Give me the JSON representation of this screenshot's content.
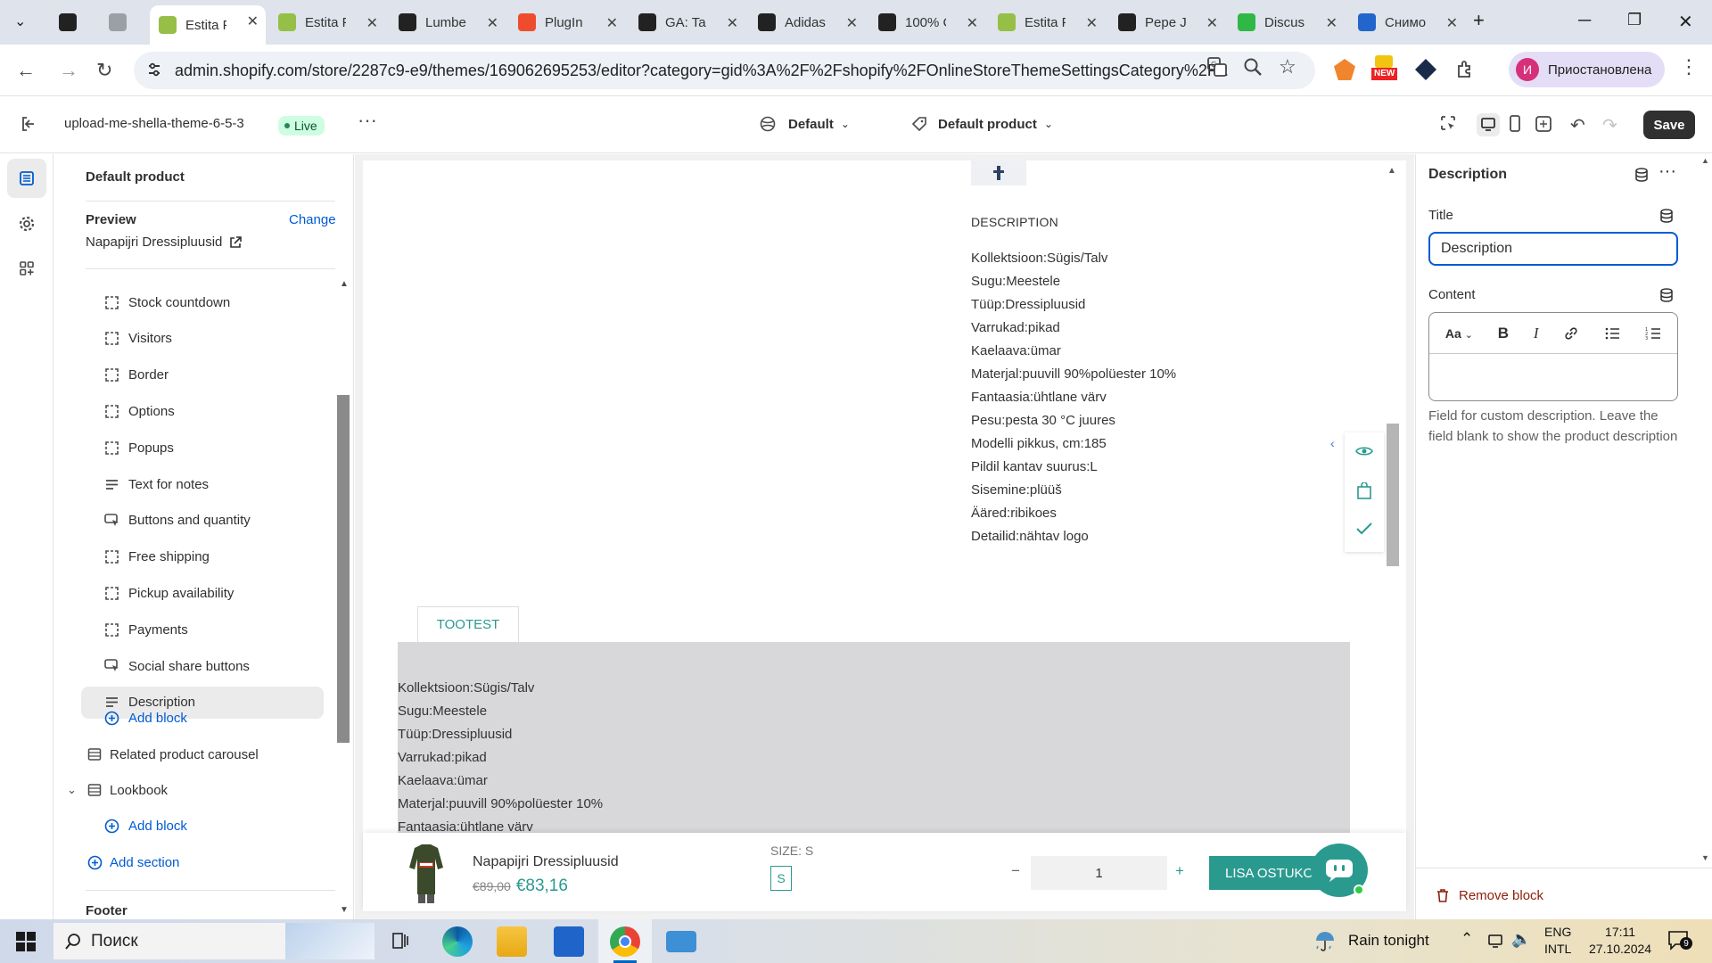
{
  "browser": {
    "tabs": [
      {
        "label": "",
        "fav_color": "#222222"
      },
      {
        "label": "",
        "fav_color": "#9aa0a6"
      },
      {
        "label": "Estita F",
        "fav_color": "#95bf47",
        "active": true
      },
      {
        "label": "Estita F",
        "fav_color": "#95bf47"
      },
      {
        "label": "Lumbe",
        "fav_color": "#222222"
      },
      {
        "label": "PlugIn",
        "fav_color": "#ee4d2d"
      },
      {
        "label": "GA: Ta",
        "fav_color": "#222222"
      },
      {
        "label": "Adidas",
        "fav_color": "#222222"
      },
      {
        "label": "100% C",
        "fav_color": "#222222"
      },
      {
        "label": "Estita F",
        "fav_color": "#95bf47"
      },
      {
        "label": "Pepe J",
        "fav_color": "#222222"
      },
      {
        "label": "Discus",
        "fav_color": "#2fb845"
      },
      {
        "label": "Снимо",
        "fav_color": "#2266cc"
      }
    ],
    "url": "admin.shopify.com/store/2287c9-e9/themes/169062695253/editor?category=gid%3A%2F%2Fshopify%2FOnlineStoreThemeSettingsCategory%2F...",
    "profile_label": "Приостановлена",
    "profile_initial": "И",
    "ext_badge": "NEW"
  },
  "header": {
    "theme_name": "upload-me-shella-theme-6-5-3",
    "live_badge": "Live",
    "template_select": "Default",
    "product_select": "Default product",
    "save_label": "Save"
  },
  "sidebar": {
    "title": "Default product",
    "preview_label": "Preview",
    "change_label": "Change",
    "preview_product": "Napapijri Dressipluusid",
    "blocks": [
      {
        "label": "Stock countdown",
        "icon": "block-icon"
      },
      {
        "label": "Visitors",
        "icon": "block-icon"
      },
      {
        "label": "Border",
        "icon": "block-icon"
      },
      {
        "label": "Options",
        "icon": "block-icon"
      },
      {
        "label": "Popups",
        "icon": "block-icon"
      },
      {
        "label": "Text for notes",
        "icon": "text-icon"
      },
      {
        "label": "Buttons and quantity",
        "icon": "buy-buttons-icon"
      },
      {
        "label": "Free shipping",
        "icon": "block-icon"
      },
      {
        "label": "Pickup availability",
        "icon": "block-icon"
      },
      {
        "label": "Payments",
        "icon": "block-icon"
      },
      {
        "label": "Social share buttons",
        "icon": "buy-buttons-icon"
      },
      {
        "label": "Description",
        "icon": "text-icon",
        "selected": true
      }
    ],
    "add_block": "Add block",
    "related_section": "Related product carousel",
    "lookbook_section": "Lookbook",
    "add_block_2": "Add block",
    "add_section": "Add section",
    "footer_label": "Footer"
  },
  "preview": {
    "description_heading": "DESCRIPTION",
    "description_lines": [
      "Kollektsioon:Sügis/Talv",
      "Sugu:Meestele",
      "Tüüp:Dressipluusid",
      "Varrukad:pikad",
      "Kaelaava:ümar",
      "Materjal:puuvill 90%polüester 10%",
      "Fantaasia:ühtlane värv",
      "Pesu:pesta 30 °C juures",
      "Modelli pikkus, cm:185",
      "Pildil kantav suurus:L",
      "Sisemine:plüüš",
      "Ääred:ribikoes",
      "Detailid:nähtav logo"
    ],
    "tab_label": "TOOTEST",
    "grey_lines": [
      "Kollektsioon:Sügis/Talv",
      "Sugu:Meestele",
      "Tüüp:Dressipluusid",
      "Varrukad:pikad",
      "Kaelaava:ümar",
      "Materjal:puuvill 90%polüester 10%",
      "Fantaasia:ühtlane värv"
    ],
    "sticky": {
      "product_name": "Napapijri Dressipluusid",
      "old_price": "€89,00",
      "new_price": "€83,16",
      "size_label": "SIZE: S",
      "size_value": "S",
      "minus": "−",
      "quantity": "1",
      "plus": "+",
      "buy_label": "LISA OSTUKORVI"
    },
    "accent_color": "#2a9a8f"
  },
  "right_panel": {
    "title": "Description",
    "title_label": "Title",
    "title_value": "Description",
    "content_label": "Content",
    "font_button": "Aa",
    "help_text": "Field for custom description. Leave the field blank to show the product description",
    "remove_label": "Remove block"
  },
  "taskbar": {
    "search_placeholder": "Поиск",
    "weather": "Rain tonight",
    "lang_top": "ENG",
    "lang_bottom": "INTL",
    "time": "17:11",
    "date": "27.10.2024",
    "notifications": "9"
  }
}
